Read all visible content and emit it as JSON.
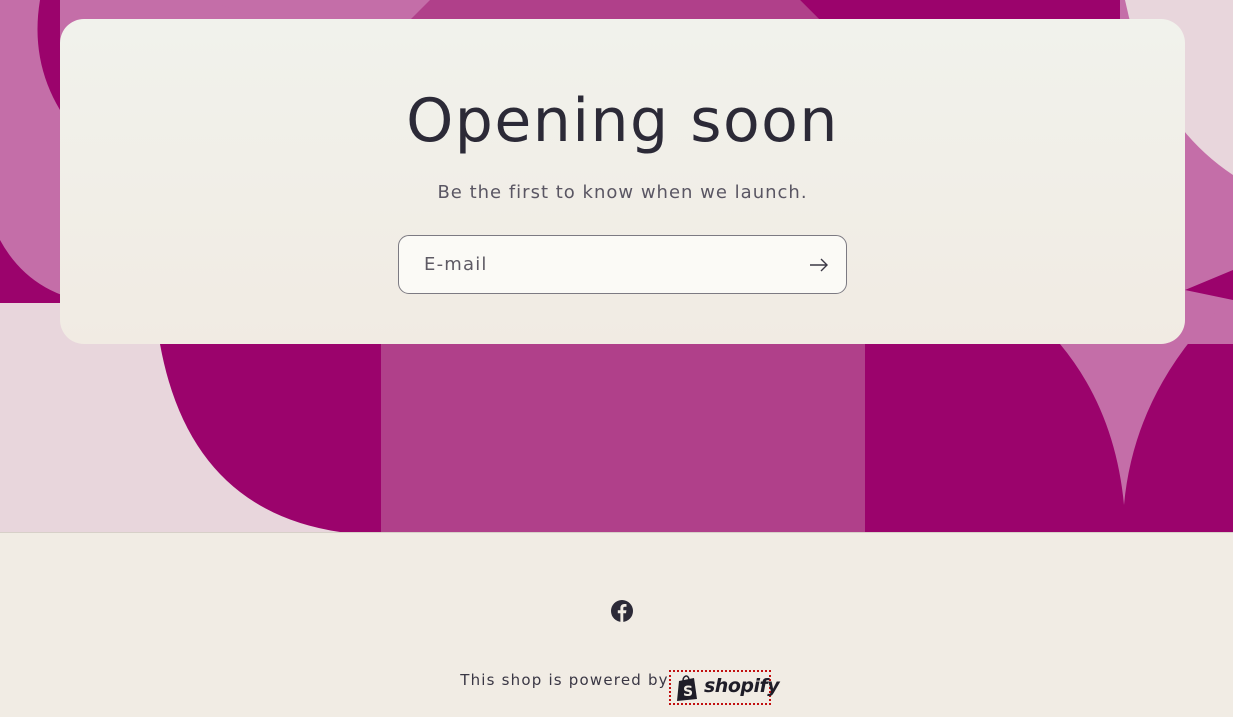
{
  "hero": {
    "title": "Opening soon",
    "subtitle": "Be the first to know when we launch.",
    "email_placeholder": "E-mail",
    "submit_icon": "arrow-right-icon"
  },
  "colors": {
    "deep_magenta": "#9b036c",
    "mid_magenta": "#b0408a",
    "light_pink": "#c46ea8",
    "pale_pink": "#e8d6dc",
    "card_bg": "#f1efe8",
    "footer_bg": "#f1ece4",
    "text_dark": "#2c2a37"
  },
  "footer": {
    "social_icon": "facebook-icon",
    "powered_by": "This shop is powered by",
    "shopify_logo_text": "shopify"
  }
}
